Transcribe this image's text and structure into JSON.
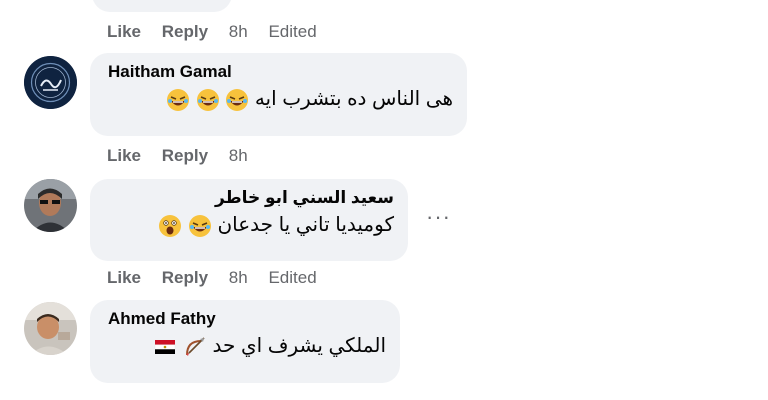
{
  "top_actions": {
    "like": "Like",
    "reply": "Reply",
    "time": "8h",
    "edited": "Edited"
  },
  "comments": [
    {
      "author": "Haitham Gamal",
      "text": "هى الناس ده بتشرب ايه",
      "emojis": [
        "rolling-laughing-face",
        "rolling-laughing-face",
        "rolling-laughing-face"
      ],
      "actions": {
        "like": "Like",
        "reply": "Reply",
        "time": "8h"
      }
    },
    {
      "author": "سعيد السني ابو خاطر",
      "text": "كوميديا تاني يا جدعان",
      "emojis": [
        "rolling-laughing-face",
        "astonished-face"
      ],
      "actions": {
        "like": "Like",
        "reply": "Reply",
        "time": "8h",
        "edited": "Edited"
      },
      "more": "···"
    },
    {
      "author": "Ahmed Fathy",
      "text": "الملكي يشرف اي حد",
      "emojis": [
        "bow-and-arrow-icon",
        "flag-egypt-icon"
      ]
    }
  ],
  "colors": {
    "bubble": "#f0f2f5",
    "meta_text": "#65676b",
    "text": "#050505"
  }
}
